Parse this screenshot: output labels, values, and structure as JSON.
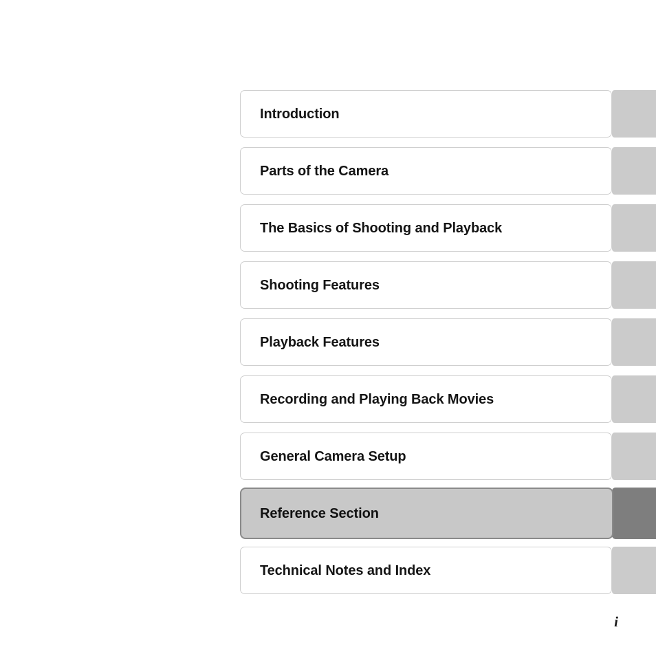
{
  "page": {
    "folio": "i",
    "background_color": "#ffffff"
  },
  "colors": {
    "tab_default": "#cbcbcb",
    "tab_active": "#7e7e7e",
    "box_default": "#ffffff",
    "box_active": "#c8c8c8",
    "border_default": "#cfcfcf",
    "border_active": "#8a8a8a",
    "text": "#141414"
  },
  "toc": {
    "sections": [
      {
        "label": "Introduction",
        "active": false
      },
      {
        "label": "Parts of the Camera",
        "active": false
      },
      {
        "label": "The Basics of Shooting and Playback",
        "active": false
      },
      {
        "label": "Shooting Features",
        "active": false
      },
      {
        "label": "Playback Features",
        "active": false
      },
      {
        "label": "Recording and Playing Back Movies",
        "active": false
      },
      {
        "label": "General Camera Setup",
        "active": false
      },
      {
        "label": "Reference Section",
        "active": true
      },
      {
        "label": "Technical Notes and Index",
        "active": false
      }
    ]
  }
}
